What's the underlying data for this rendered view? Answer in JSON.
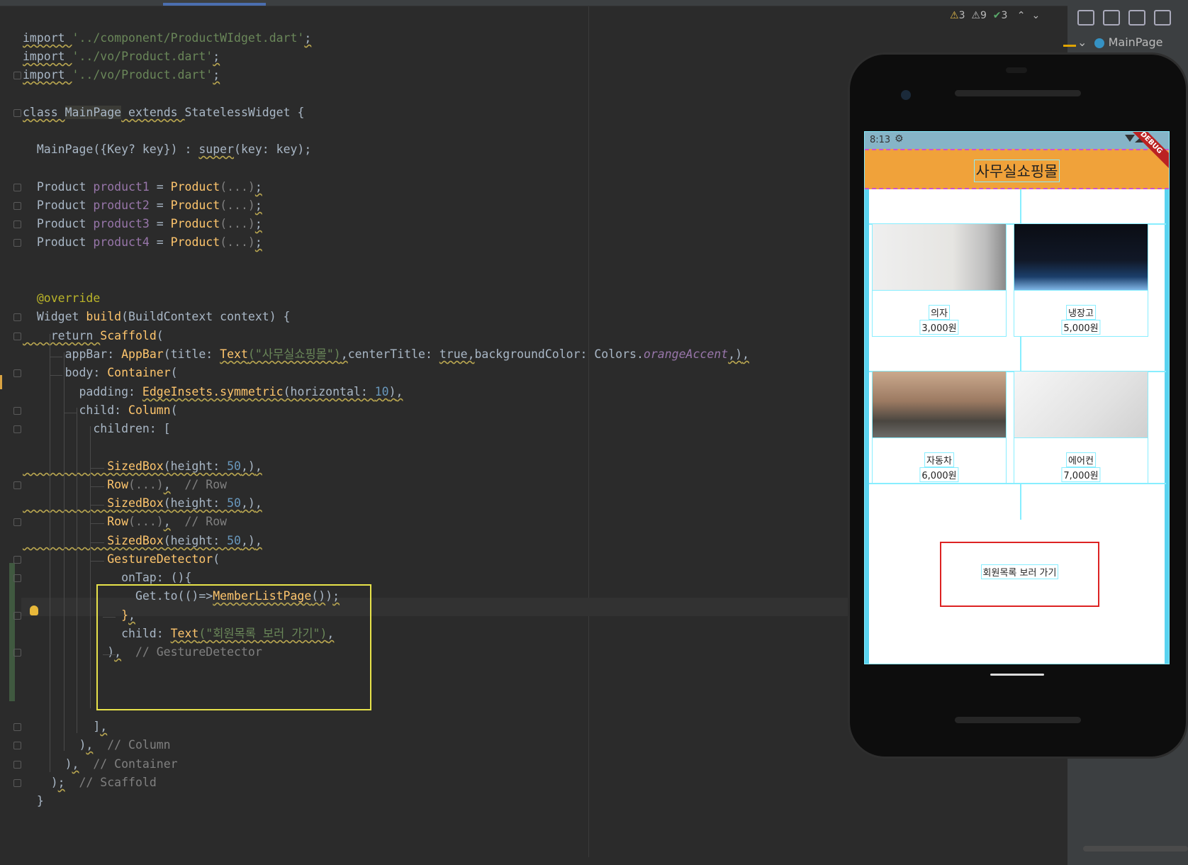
{
  "editor": {
    "lines": [
      {
        "tokens": [
          [
            "kw",
            "import "
          ],
          [
            "str",
            "'../component/ProductWIdget.dart'"
          ],
          [
            "kw",
            ";"
          ]
        ]
      },
      {
        "tokens": [
          [
            "kw",
            "import "
          ],
          [
            "str",
            "'../vo/Product.dart'"
          ],
          [
            "kw",
            ";"
          ]
        ]
      },
      {
        "tokens": [
          [
            "kw",
            "import "
          ],
          [
            "str",
            "'../vo/Product.dart'"
          ],
          [
            "kw",
            ";"
          ]
        ]
      },
      {
        "tokens": [
          [
            "kw",
            "class "
          ],
          [
            "hlcls",
            "MainPage"
          ],
          [
            "kw",
            " extends "
          ],
          [
            "plain",
            "StatelessWidget {"
          ]
        ]
      },
      {
        "tokens": [
          [
            "plain",
            "  MainPage({Key? key}) : "
          ],
          [
            "kw",
            "super"
          ],
          [
            "plain",
            "(key: key);"
          ]
        ]
      },
      {
        "tokens": [
          [
            "plain",
            "  Product "
          ],
          [
            "fld",
            "product1"
          ],
          [
            "plain",
            " = "
          ],
          [
            "fn",
            "Product"
          ],
          [
            "cm",
            "(...)"
          ],
          [
            "kw",
            ";"
          ]
        ]
      },
      {
        "tokens": [
          [
            "plain",
            "  Product "
          ],
          [
            "fld",
            "product2"
          ],
          [
            "plain",
            " = "
          ],
          [
            "fn",
            "Product"
          ],
          [
            "cm",
            "(...)"
          ],
          [
            "kw",
            ";"
          ]
        ]
      },
      {
        "tokens": [
          [
            "plain",
            "  Product "
          ],
          [
            "fld",
            "product3"
          ],
          [
            "plain",
            " = "
          ],
          [
            "fn",
            "Product"
          ],
          [
            "cm",
            "(...)"
          ],
          [
            "kw",
            ";"
          ]
        ]
      },
      {
        "tokens": [
          [
            "plain",
            "  Product "
          ],
          [
            "fld",
            "product4"
          ],
          [
            "plain",
            " = "
          ],
          [
            "fn",
            "Product"
          ],
          [
            "cm",
            "(...)"
          ],
          [
            "kw",
            ";"
          ]
        ]
      },
      {
        "tokens": [
          [
            "ann",
            "  @override"
          ]
        ]
      },
      {
        "tokens": [
          [
            "plain",
            "  Widget "
          ],
          [
            "fn",
            "build"
          ],
          [
            "plain",
            "(BuildContext context) {"
          ]
        ]
      },
      {
        "tokens": [
          [
            "kw",
            "    return "
          ],
          [
            "fn",
            "Scaffold"
          ],
          [
            "plain",
            "("
          ]
        ]
      },
      {
        "tokens": [
          [
            "plain",
            "      appBar: "
          ],
          [
            "fn",
            "AppBar"
          ],
          [
            "plain",
            "(title: "
          ],
          [
            "fnw",
            "Text"
          ],
          [
            "strw",
            "(\"사무실쇼핑몰\")"
          ],
          [
            "kw",
            ","
          ],
          [
            "plain",
            "centerTitle: "
          ],
          [
            "kw",
            "true,"
          ],
          [
            "plain",
            "backgroundColor: Colors."
          ],
          [
            "itl",
            "orangeAccent"
          ],
          [
            "kw",
            ",)"
          ],
          [
            "kw",
            ","
          ]
        ]
      },
      {
        "tokens": [
          [
            "plain",
            "      body: "
          ],
          [
            "fn",
            "Container"
          ],
          [
            "plain",
            "("
          ]
        ]
      },
      {
        "tokens": [
          [
            "plain",
            "        padding: "
          ],
          [
            "fnw",
            "EdgeInsets.symmetric"
          ],
          [
            "plainw",
            "(horizontal: "
          ],
          [
            "numw",
            "10"
          ],
          [
            "plainw",
            ")"
          ],
          [
            "kw",
            ","
          ]
        ]
      },
      {
        "tokens": [
          [
            "plain",
            "        child: "
          ],
          [
            "fn",
            "Column"
          ],
          [
            "plain",
            "("
          ]
        ]
      },
      {
        "tokens": [
          [
            "plain",
            "          children: ["
          ]
        ]
      },
      {
        "tokens": [
          [
            "fnw",
            "            SizedBox"
          ],
          [
            "plainw",
            "(height: "
          ],
          [
            "numw",
            "50"
          ],
          [
            "plainw",
            ",)"
          ],
          [
            "kw",
            ","
          ]
        ]
      },
      {
        "tokens": [
          [
            "fn",
            "            Row"
          ],
          [
            "cm",
            "(...)"
          ],
          [
            "kw",
            ","
          ],
          [
            "cm",
            "  // Row"
          ]
        ]
      },
      {
        "tokens": [
          [
            "fnw",
            "            SizedBox"
          ],
          [
            "plainw",
            "(height: "
          ],
          [
            "numw",
            "50"
          ],
          [
            "plainw",
            ",)"
          ],
          [
            "kw",
            ","
          ]
        ]
      },
      {
        "tokens": [
          [
            "fn",
            "            Row"
          ],
          [
            "cm",
            "(...)"
          ],
          [
            "kw",
            ","
          ],
          [
            "cm",
            "  // Row"
          ]
        ]
      },
      {
        "tokens": [
          [
            "fnw",
            "            SizedBox"
          ],
          [
            "plainw",
            "(height: "
          ],
          [
            "numw",
            "50"
          ],
          [
            "plainw",
            ",)"
          ],
          [
            "kw",
            ","
          ]
        ]
      },
      {
        "tokens": [
          [
            "fn",
            "            GestureDetector"
          ],
          [
            "plain",
            "("
          ]
        ]
      },
      {
        "tokens": [
          [
            "plain",
            "              onTap: (){"
          ]
        ]
      },
      {
        "tokens": [
          [
            "plain",
            "                Get.to(()=>"
          ],
          [
            "fnw",
            "MemberListPage"
          ],
          [
            "plainw",
            "()"
          ],
          [
            "plain",
            ")"
          ],
          [
            "kw",
            ";"
          ]
        ]
      },
      {
        "tokens": [
          [
            "fn",
            "              }"
          ],
          [
            "kw",
            ","
          ]
        ]
      },
      {
        "tokens": [
          [
            "plain",
            "              child: "
          ],
          [
            "fnw",
            "Text"
          ],
          [
            "strw",
            "(\"회원목록 보러 가기\")"
          ],
          [
            "kw",
            ","
          ]
        ]
      },
      {
        "tokens": [
          [
            "plain",
            "            )"
          ],
          [
            "kw",
            ","
          ],
          [
            "cm",
            "  // GestureDetector"
          ]
        ]
      },
      {
        "tokens": [
          [
            "plain",
            "          ]"
          ],
          [
            "kw",
            ","
          ]
        ]
      },
      {
        "tokens": [
          [
            "plain",
            "        )"
          ],
          [
            "kw",
            ","
          ],
          [
            "cm",
            "  // Column"
          ]
        ]
      },
      {
        "tokens": [
          [
            "plain",
            "      )"
          ],
          [
            "kw",
            ","
          ],
          [
            "cm",
            "  // Container"
          ]
        ]
      },
      {
        "tokens": [
          [
            "plain",
            "    )"
          ],
          [
            "kw",
            ";"
          ],
          [
            "cm",
            "  // Scaffold"
          ]
        ]
      },
      {
        "tokens": [
          [
            "plain",
            "  }"
          ]
        ]
      }
    ]
  },
  "inspections": {
    "warnings": "3",
    "weak_warnings": "9",
    "typos": "3"
  },
  "breadcrumb": {
    "label": "MainPage"
  },
  "device": {
    "status_time": "8:13",
    "debug_banner": "DEBUG",
    "app_title": "사무실쇼핑몰",
    "products": [
      {
        "name": "의자",
        "price": "3,000원",
        "image": "chair-image"
      },
      {
        "name": "냉장고",
        "price": "5,000원",
        "image": "fridge-image"
      },
      {
        "name": "자동차",
        "price": "6,000원",
        "image": "car-image"
      },
      {
        "name": "에어컨",
        "price": "7,000원",
        "image": "aircon-image"
      }
    ],
    "member_button": "회원목록 보러 가기"
  }
}
